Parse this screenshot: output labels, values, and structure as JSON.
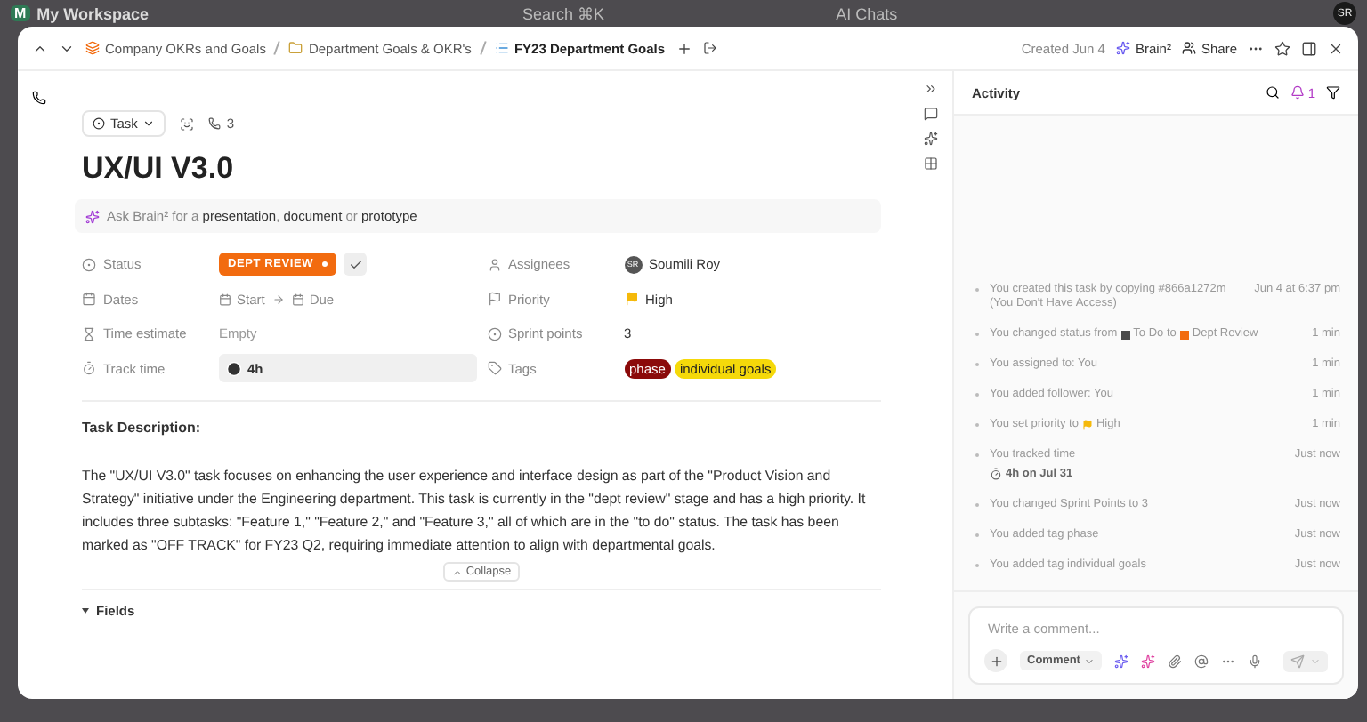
{
  "backdrop": {
    "workspace": "My Workspace",
    "workspace_initial": "M",
    "search": "Search ⌘K",
    "ai_chats": "AI Chats",
    "avatar": "SR"
  },
  "header": {
    "breadcrumbs": [
      {
        "label": "Company OKRs and Goals",
        "kind": "space"
      },
      {
        "label": "Department Goals & OKR's",
        "kind": "folder"
      },
      {
        "label": "FY23 Department Goals",
        "kind": "list"
      }
    ],
    "created": "Created Jun 4",
    "brain": "Brain²",
    "share": "Share"
  },
  "task": {
    "type": "Task",
    "subtask_count": "3",
    "title": "UX/UI V3.0",
    "ask": {
      "prefix": "Ask Brain² for a",
      "options": [
        "presentation",
        "document",
        "prototype"
      ],
      "sep": ",",
      "or": "or"
    },
    "fields": [
      {
        "label": "Status",
        "kind": "status",
        "value": "DEPT REVIEW"
      },
      {
        "label": "Assignees",
        "kind": "person",
        "value": "Soumili Roy",
        "initials": "SR"
      },
      {
        "label": "Dates",
        "kind": "dates",
        "start": "Start",
        "due": "Due"
      },
      {
        "label": "Priority",
        "kind": "priority",
        "value": "High"
      },
      {
        "label": "Time estimate",
        "kind": "empty",
        "value": "Empty"
      },
      {
        "label": "Sprint points",
        "kind": "text",
        "value": "3"
      },
      {
        "label": "Track time",
        "kind": "timer",
        "value": "4h"
      },
      {
        "label": "Tags",
        "kind": "tags",
        "tags": [
          {
            "label": "phase",
            "color": "#8b0a0a"
          },
          {
            "label": "individual goals",
            "color": "#f5d90a"
          }
        ]
      }
    ],
    "description_heading": "Task Description:",
    "description": "The \"UX/UI V3.0\" task focuses on enhancing the user experience and interface design as part of the \"Product Vision and Strategy\" initiative under the Engineering department. This task is currently in the \"dept review\" stage and has a high priority. It includes three subtasks: \"Feature 1,\" \"Feature 2,\" and \"Feature 3,\" all of which are in the \"to do\" status. The task has been marked as \"OFF TRACK\" for FY23 Q2, requiring immediate attention to align with departmental goals.",
    "collapse": "Collapse",
    "fields_section": {
      "label": "Fields",
      "expanded": true
    }
  },
  "activity": {
    "title": "Activity",
    "notifications": "1",
    "entries": [
      {
        "text": "You created this task by copying #866a1272m (You Don't Have Access)",
        "time": "Jun 4 at 6:37 pm"
      },
      {
        "text": "You changed status from",
        "from": {
          "label": "To Do",
          "color": "#4a4a4a"
        },
        "joiner": "to",
        "to": {
          "label": "Dept Review",
          "color": "#f26b0f"
        },
        "time": "1 min"
      },
      {
        "text": "You assigned to: You",
        "time": "1 min"
      },
      {
        "text": "You added follower: You",
        "time": "1 min"
      },
      {
        "text": "You set priority to",
        "priority": "High",
        "time": "1 min"
      },
      {
        "text": "You tracked time",
        "detail": "4h on Jul 31",
        "time": "Just now"
      },
      {
        "text": "You changed Sprint Points to 3",
        "time": "Just now"
      },
      {
        "text": "You added tag phase",
        "time": "Just now"
      },
      {
        "text": "You added tag individual goals",
        "time": "Just now"
      }
    ],
    "comment_placeholder": "Write a comment...",
    "comment_mode": "Comment"
  }
}
